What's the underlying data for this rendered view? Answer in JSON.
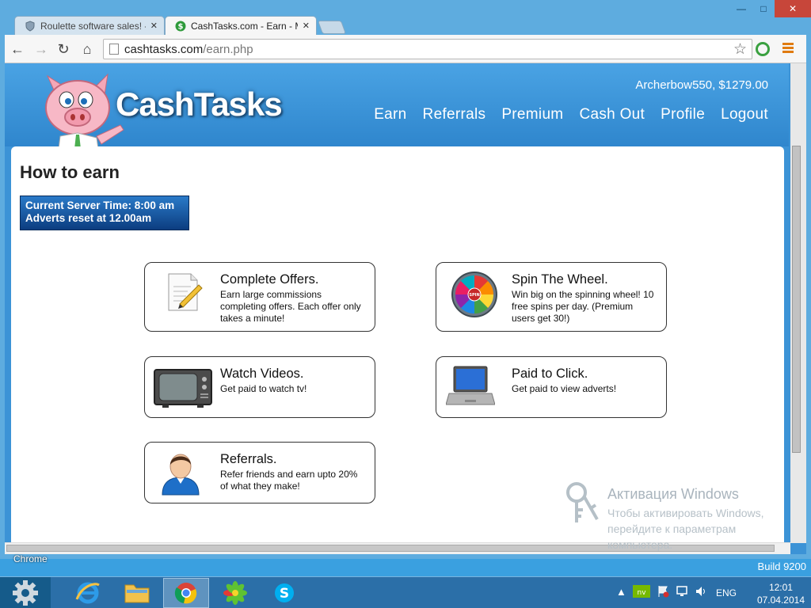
{
  "browser": {
    "tabs": [
      {
        "label": "Roulette software sales! - S",
        "active": false
      },
      {
        "label": "CashTasks.com - Earn - M",
        "active": true
      }
    ],
    "url_host": "cashtasks.com",
    "url_path": "/earn.php",
    "close_glyph": "✕",
    "min_glyph": "—",
    "max_glyph": "□"
  },
  "site": {
    "logo_text": "CashTasks",
    "user_info": "Archerbow550, $1279.00",
    "nav": [
      "Earn",
      "Referrals",
      "Premium",
      "Cash Out",
      "Profile",
      "Logout"
    ]
  },
  "page": {
    "title": "How to earn",
    "server_time": "Current Server Time: 8:00 am",
    "reset_note": "Adverts reset at 12.00am",
    "cards": [
      {
        "title": "Complete Offers.",
        "desc": "Earn large commissions completing offers. Each offer only takes a minute!",
        "icon": "document-pencil-icon"
      },
      {
        "title": "Spin The Wheel.",
        "desc": "Win big on the spinning wheel! 10 free spins per day. (Premium users get 30!)",
        "icon": "spin-wheel-icon"
      },
      {
        "title": "Watch Videos.",
        "desc": "Get paid to watch tv!",
        "icon": "television-icon"
      },
      {
        "title": "Paid to Click.",
        "desc": "Get paid to view adverts!",
        "icon": "laptop-icon"
      },
      {
        "title": "Referrals.",
        "desc": "Refer friends and earn upto 20% of what they make!",
        "icon": "person-icon"
      }
    ],
    "wheel_label": "SPIN"
  },
  "os": {
    "activation_title": "Активация Windows",
    "activation_text": "Чтобы активировать Windows, перейдите к параметрам компьютера.",
    "chrome_label": "Chrome",
    "build": "Build 9200",
    "lang": "ENG",
    "time": "12:01",
    "date": "07.04.2014"
  },
  "colors": {
    "header_blue": "#3a94d8",
    "page_background": "#3c93d6",
    "timebox": "#0c3d80"
  }
}
